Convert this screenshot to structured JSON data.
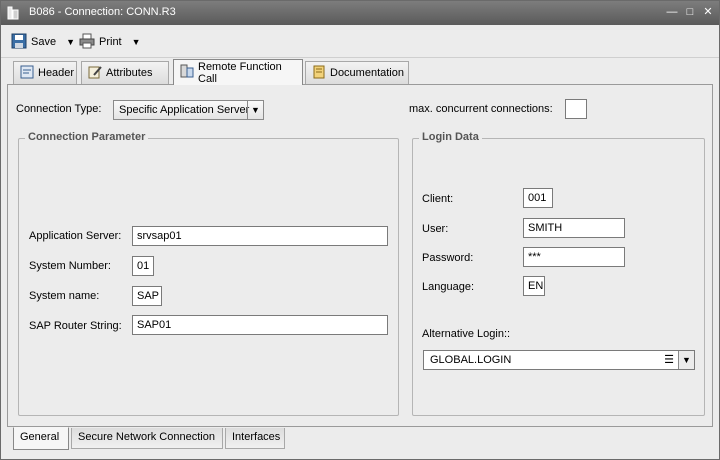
{
  "window": {
    "title": "B086 - Connection: CONN.R3"
  },
  "toolbar": {
    "save_label": "Save",
    "print_label": "Print"
  },
  "tabs_top": [
    "Header",
    "Attributes",
    "Remote Function Call",
    "Documentation"
  ],
  "connection": {
    "type_label": "Connection Type:",
    "type_value": "Specific Application Server",
    "max_label": "max. concurrent connections:",
    "max_value": ""
  },
  "connection_parameter": {
    "title": "Connection Parameter",
    "app_server_label": "Application Server:",
    "app_server_value": "srvsap01",
    "system_number_label": "System Number:",
    "system_number_value": "01",
    "system_name_label": "System name:",
    "system_name_value": "SAP",
    "router_label": "SAP Router String:",
    "router_value": "SAP01"
  },
  "login_data": {
    "title": "Login Data",
    "client_label": "Client:",
    "client_value": "001",
    "user_label": "User:",
    "user_value": "SMITH",
    "password_label": "Password:",
    "password_value": "***",
    "language_label": "Language:",
    "language_value": "EN",
    "alt_login_label": "Alternative Login::",
    "alt_login_value": "GLOBAL.LOGIN"
  },
  "tabs_bottom": [
    "General",
    "Secure Network Connection",
    "Interfaces"
  ]
}
